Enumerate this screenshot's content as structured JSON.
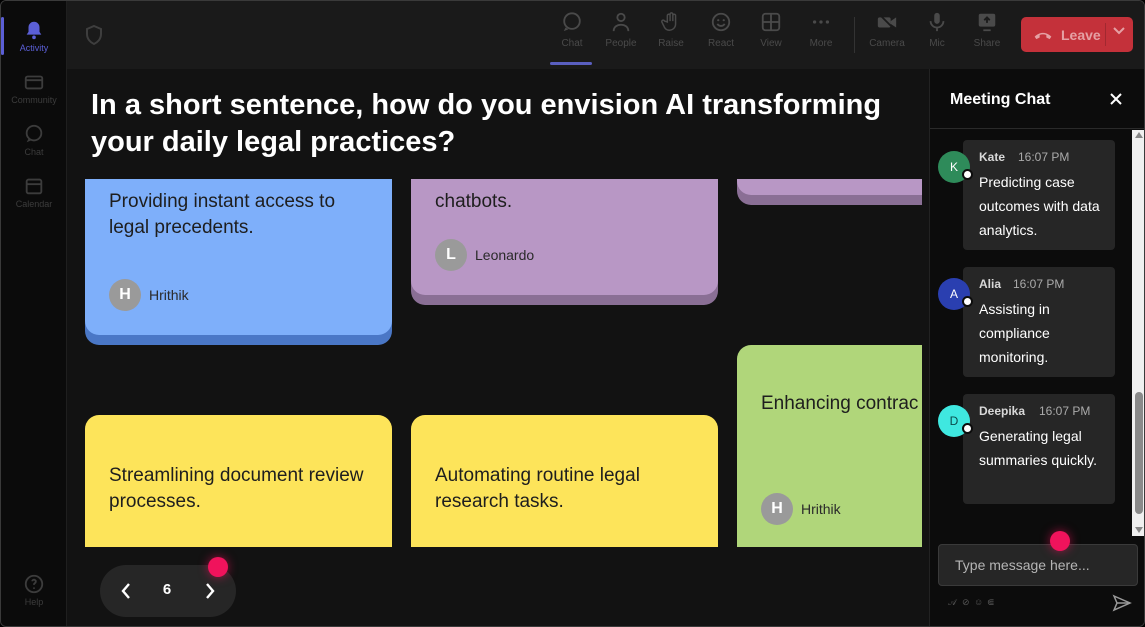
{
  "rail": {
    "items": [
      {
        "label": "Activity",
        "icon": "bell-icon"
      },
      {
        "label": "Community",
        "icon": "community-icon"
      },
      {
        "label": "Chat",
        "icon": "chat-icon"
      },
      {
        "label": "Calendar",
        "icon": "calendar-icon"
      },
      {
        "label": "Help",
        "icon": "help-icon"
      }
    ]
  },
  "toolbar": {
    "chat": "Chat",
    "people": "People",
    "raise": "Raise",
    "react": "React",
    "view": "View",
    "more": "More",
    "camera": "Camera",
    "mic": "Mic",
    "share": "Share",
    "leave": "Leave"
  },
  "stage": {
    "question": "In a short sentence, how do you envision AI transforming your daily legal practices?",
    "cards": [
      {
        "text": "Providing instant access to legal precedents.",
        "author": "Hrithik",
        "initial": "H",
        "color": "#7eaffa"
      },
      {
        "text": "chatbots.",
        "author": "Leonardo",
        "initial": "L",
        "color": "#b897c5"
      },
      {
        "text": "",
        "author": "",
        "initial": "",
        "color": "#b897c5"
      },
      {
        "text": "Streamlining document review processes.",
        "author": "",
        "initial": "",
        "color": "#fde45a"
      },
      {
        "text": "Automating routine legal research tasks.",
        "author": "",
        "initial": "",
        "color": "#fde45a"
      },
      {
        "text": "Enhancing contrac accuracy.",
        "author": "Hrithik",
        "initial": "H",
        "color": "#b0d67a"
      }
    ],
    "page": "6"
  },
  "chat": {
    "title": "Meeting Chat",
    "messages": [
      {
        "name": "Kate",
        "initial": "K",
        "time": "16:07 PM",
        "text": "Predicting case outcomes with data analytics.",
        "color": "#2e8b5a"
      },
      {
        "name": "Alia",
        "initial": "A",
        "time": "16:07 PM",
        "text": "Assisting in compliance monitoring.",
        "color": "#2a3fb0"
      },
      {
        "name": "Deepika",
        "initial": "D",
        "time": "16:07 PM",
        "text": "Generating legal summaries quickly.",
        "color": "#3fe8e0"
      }
    ],
    "input_placeholder": "Type message here..."
  },
  "colors": {
    "accent": "#5b5fd6",
    "leave": "#c4313a",
    "notification": "#f0135c"
  }
}
